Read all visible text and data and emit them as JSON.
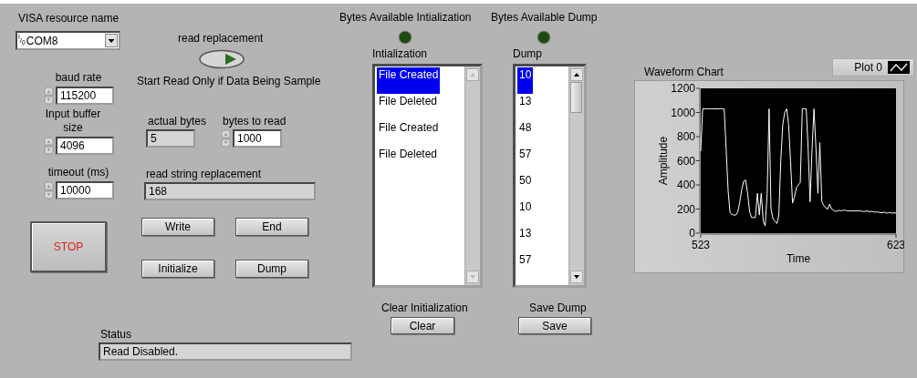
{
  "visa_resource": {
    "label": "VISA resource name",
    "io_mark": "$^{I}$/$_{0}$",
    "value": "COM8"
  },
  "read_replacement": {
    "label": "read replacement",
    "on": false
  },
  "note": "Start Read Only if Data Being Sample",
  "numerics": [
    {
      "kind": "control",
      "label": "baud rate",
      "value": "115200"
    },
    {
      "kind": "control",
      "label": "Input buffer size",
      "value": "4096"
    },
    {
      "kind": "control",
      "label": "timeout (ms)",
      "value": "10000"
    },
    {
      "kind": "indicator",
      "label": "actual bytes",
      "value": "5"
    },
    {
      "kind": "control",
      "label": "bytes to read",
      "value": "1000"
    },
    {
      "kind": "indicator",
      "label": "read string replacement",
      "value": "168"
    }
  ],
  "buttons": [
    {
      "kind": "stop",
      "label": "STOP"
    },
    {
      "kind": "push",
      "label": "Write"
    },
    {
      "kind": "push",
      "label": "End"
    },
    {
      "kind": "push",
      "label": "Initialize"
    },
    {
      "kind": "push",
      "label": "Dump"
    }
  ],
  "status": {
    "label": "Status",
    "value": "Read Disabled."
  },
  "leds": [
    {
      "label": "Bytes Available Intialization",
      "on": false
    },
    {
      "label": "Bytes Available Dump",
      "on": false
    }
  ],
  "lists": [
    {
      "label": "Intialization",
      "scrollbar_enabled": false,
      "items": [
        {
          "text": "File Created",
          "selected": true
        },
        {
          "text": "File Deleted",
          "selected": false
        },
        {
          "text": "File Created",
          "selected": false
        },
        {
          "text": "File Deleted",
          "selected": false
        }
      ]
    },
    {
      "label": "Dump",
      "scrollbar_enabled": true,
      "items": [
        {
          "text": "10",
          "selected": true
        },
        {
          "text": "13",
          "selected": false
        },
        {
          "text": "48",
          "selected": false
        },
        {
          "text": "57",
          "selected": false
        },
        {
          "text": "50",
          "selected": false
        },
        {
          "text": "10",
          "selected": false
        },
        {
          "text": "13",
          "selected": false
        },
        {
          "text": "57",
          "selected": false
        }
      ]
    }
  ],
  "list_buttons": [
    {
      "caption": "Clear Initialization",
      "label": "Clear"
    },
    {
      "caption": "Save Dump",
      "label": "Save"
    }
  ],
  "chart": {
    "title": "Waveform Chart",
    "chart_data": {
      "type": "line",
      "xlabel": "Time",
      "x": [
        523,
        524,
        525,
        526,
        527,
        528,
        529,
        530,
        531,
        532,
        533,
        534,
        535,
        536,
        537,
        538,
        539,
        540,
        541,
        542,
        543,
        544,
        545,
        546,
        547,
        548,
        549,
        550,
        551,
        552,
        553,
        554,
        555,
        556,
        557,
        558,
        559,
        560,
        561,
        562,
        563,
        564,
        565,
        566,
        567,
        568,
        569,
        570,
        571,
        572,
        573,
        574,
        575,
        576,
        577,
        578,
        579,
        580,
        581,
        582,
        583,
        584,
        585,
        586,
        587,
        588,
        589,
        590,
        591,
        592,
        593,
        594,
        595,
        596,
        597,
        598,
        599,
        600,
        601,
        602,
        603,
        604,
        605,
        606,
        607,
        608,
        609,
        610,
        611,
        612,
        613,
        614,
        615,
        616,
        617,
        618,
        619,
        620,
        621,
        622,
        623
      ],
      "ylabel": "Amplitude",
      "xlim": [
        523,
        623
      ],
      "ylim": [
        0,
        1200
      ],
      "xticks": [
        523,
        623
      ],
      "yticks": [
        0,
        200,
        400,
        600,
        800,
        1000,
        1200
      ],
      "series": [
        {
          "name": "Plot 0",
          "color": "#ffffff",
          "values": [
            680,
            1030,
            1030,
            1030,
            1030,
            1030,
            1030,
            1030,
            1030,
            1030,
            1030,
            1030,
            1030,
            700,
            350,
            170,
            155,
            150,
            150,
            180,
            260,
            360,
            430,
            440,
            330,
            180,
            130,
            130,
            130,
            330,
            150,
            330,
            100,
            60,
            330,
            1030,
            200,
            120,
            100,
            80,
            150,
            600,
            900,
            1000,
            1030,
            900,
            600,
            250,
            300,
            380,
            400,
            420,
            1030,
            1030,
            1030,
            700,
            260,
            700,
            1030,
            700,
            330,
            750,
            260,
            230,
            210,
            200,
            240,
            200,
            190,
            180,
            185,
            190,
            185,
            190,
            190,
            185,
            185,
            185,
            185,
            185,
            185,
            185,
            185,
            180,
            180,
            185,
            180,
            180,
            180,
            175,
            175,
            175,
            170,
            170,
            175,
            165,
            170,
            170,
            165,
            170,
            165
          ]
        }
      ]
    }
  }
}
